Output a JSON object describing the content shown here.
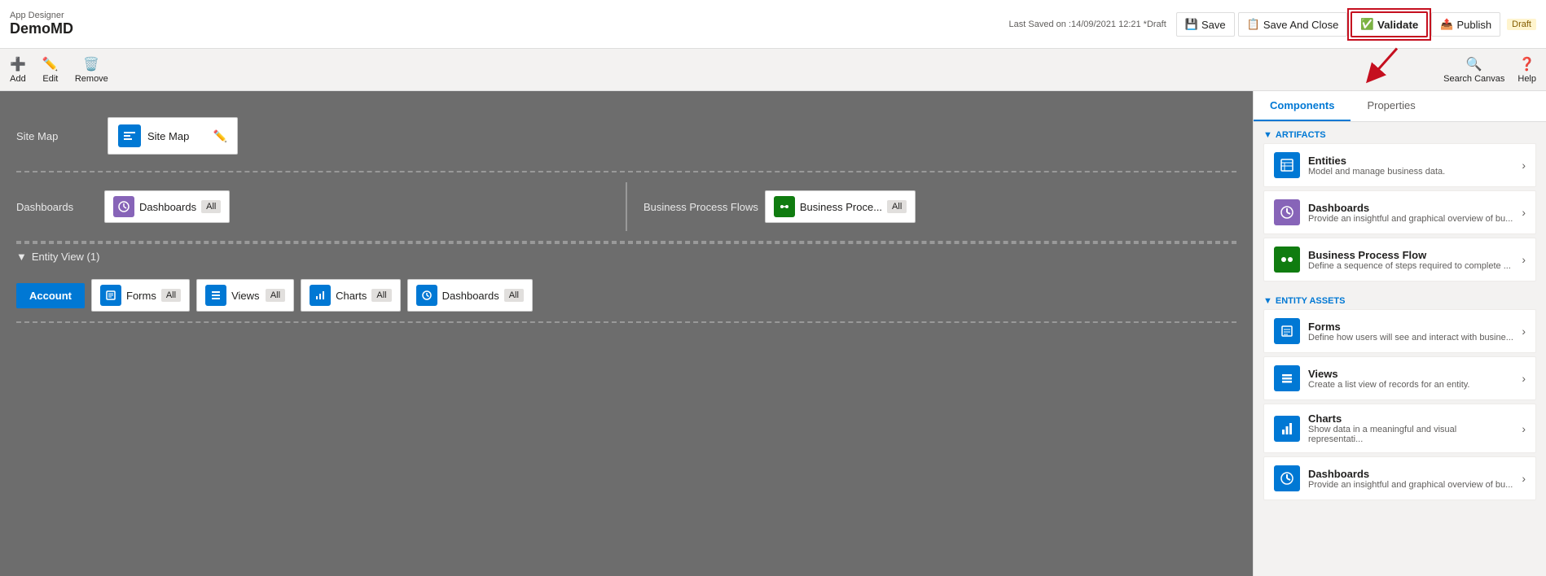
{
  "header": {
    "app_designer_label": "App Designer",
    "app_name": "DemoMD",
    "last_saved": "Last Saved on :14/09/2021 12:21 *Draft",
    "save_label": "Save",
    "save_and_close_label": "Save And Close",
    "validate_label": "Validate",
    "publish_label": "Publish",
    "draft_label": "Draft"
  },
  "toolbar": {
    "add_label": "Add",
    "edit_label": "Edit",
    "remove_label": "Remove",
    "search_canvas_label": "Search Canvas",
    "help_label": "Help"
  },
  "canvas": {
    "site_map_label": "Site Map",
    "site_map_box_label": "Site Map",
    "dashboards_label": "Dashboards",
    "dashboards_box_label": "Dashboards",
    "dashboards_all": "All",
    "business_process_flows_label": "Business Process Flows",
    "business_process_box_label": "Business Proce...",
    "business_process_all": "All",
    "entity_view_label": "Entity View (1)",
    "account_label": "Account",
    "forms_label": "Forms",
    "forms_all": "All",
    "views_label": "Views",
    "views_all": "All",
    "charts_label": "Charts",
    "charts_all": "All",
    "entity_dashboards_label": "Dashboards",
    "entity_dashboards_all": "All"
  },
  "right_panel": {
    "components_tab": "Components",
    "properties_tab": "Properties",
    "artifacts_label": "ARTIFACTS",
    "entities_title": "Entities",
    "entities_desc": "Model and manage business data.",
    "dashboards_title": "Dashboards",
    "dashboards_desc": "Provide an insightful and graphical overview of bu...",
    "bpf_title": "Business Process Flow",
    "bpf_desc": "Define a sequence of steps required to complete ...",
    "entity_assets_label": "ENTITY ASSETS",
    "forms_title": "Forms",
    "forms_desc": "Define how users will see and interact with busine...",
    "views_title": "Views",
    "views_desc": "Create a list view of records for an entity.",
    "charts_title": "Charts",
    "charts_desc": "Show data in a meaningful and visual representati...",
    "ea_dashboards_title": "Dashboards",
    "ea_dashboards_desc": "Provide an insightful and graphical overview of bu..."
  }
}
